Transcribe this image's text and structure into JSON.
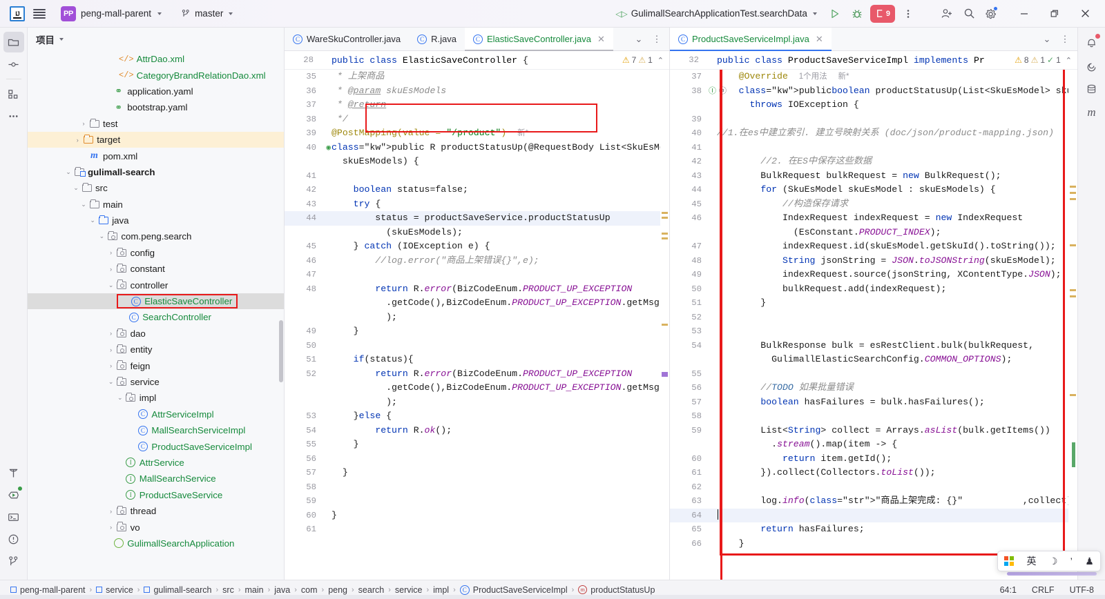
{
  "titlebar": {
    "logo_alt": "IJ",
    "project_badge": "PP",
    "project_name": "peng-mall-parent",
    "branch": "master",
    "run_config": "GulimallSearchApplicationTest.searchData",
    "run_count_badge": "9"
  },
  "rail": {
    "items": [
      {
        "name": "project-tool-window",
        "icon": "folder-icon"
      },
      {
        "name": "commit-tool-window",
        "icon": "commit-icon"
      },
      {
        "name": "structure-tool-window",
        "icon": "structure-icon"
      },
      {
        "name": "more-tool-windows",
        "icon": "more-icon"
      },
      {
        "name": "build-tool-window",
        "icon": "hammer-icon"
      },
      {
        "name": "run-tool-window",
        "icon": "run-icon"
      },
      {
        "name": "terminal-tool-window",
        "icon": "terminal-icon"
      },
      {
        "name": "problems-tool-window",
        "icon": "warning-icon"
      },
      {
        "name": "version-control-tool-window",
        "icon": "branch-icon"
      }
    ]
  },
  "right_rail": {
    "items": [
      {
        "name": "notifications",
        "icon": "bell-icon"
      },
      {
        "name": "ai-assistant",
        "icon": "spiral-icon"
      },
      {
        "name": "database",
        "icon": "database-icon"
      },
      {
        "name": "maven",
        "icon": "maven-m-icon"
      }
    ]
  },
  "project": {
    "title": "项目",
    "tree": [
      {
        "indent": 5,
        "arrow": "",
        "icon": "xml-file",
        "label": "AttrDao.xml",
        "color": "green"
      },
      {
        "indent": 5,
        "arrow": "",
        "icon": "xml-file",
        "label": "CategoryBrandRelationDao.xml",
        "color": "green"
      },
      {
        "indent": 4.6,
        "arrow": "",
        "icon": "yaml-file",
        "label": "application.yaml",
        "color": "plain"
      },
      {
        "indent": 4.6,
        "arrow": "",
        "icon": "yaml-file",
        "label": "bootstrap.yaml",
        "color": "plain"
      },
      {
        "indent": 3,
        "arrow": "right",
        "icon": "folder",
        "label": "test",
        "color": "plain"
      },
      {
        "indent": 2.6,
        "arrow": "right",
        "icon": "folder-orange",
        "label": "target",
        "color": "plain",
        "highlight": true
      },
      {
        "indent": 3,
        "arrow": "",
        "icon": "maven-m",
        "label": "pom.xml",
        "color": "plain"
      },
      {
        "indent": 2,
        "arrow": "down",
        "icon": "module",
        "label": "gulimall-search",
        "color": "plain",
        "bold": true
      },
      {
        "indent": 2.5,
        "arrow": "down",
        "icon": "folder",
        "label": "src",
        "color": "plain"
      },
      {
        "indent": 3,
        "arrow": "down",
        "icon": "folder",
        "label": "main",
        "color": "plain"
      },
      {
        "indent": 3.6,
        "arrow": "down",
        "icon": "folder-blue",
        "label": "java",
        "color": "plain"
      },
      {
        "indent": 4.2,
        "arrow": "down",
        "icon": "package",
        "label": "com.peng.search",
        "color": "plain"
      },
      {
        "indent": 4.8,
        "arrow": "right",
        "icon": "package",
        "label": "config",
        "color": "plain"
      },
      {
        "indent": 4.8,
        "arrow": "right",
        "icon": "package",
        "label": "constant",
        "color": "plain"
      },
      {
        "indent": 4.8,
        "arrow": "down",
        "icon": "package",
        "label": "controller",
        "color": "plain"
      },
      {
        "indent": 5.6,
        "arrow": "",
        "icon": "class",
        "label": "ElasticSaveController",
        "color": "green",
        "selected": true,
        "boxed": true
      },
      {
        "indent": 5.6,
        "arrow": "",
        "icon": "class",
        "label": "SearchController",
        "color": "green"
      },
      {
        "indent": 4.8,
        "arrow": "right",
        "icon": "package",
        "label": "dao",
        "color": "plain"
      },
      {
        "indent": 4.8,
        "arrow": "right",
        "icon": "package",
        "label": "entity",
        "color": "plain"
      },
      {
        "indent": 4.8,
        "arrow": "right",
        "icon": "package",
        "label": "feign",
        "color": "plain"
      },
      {
        "indent": 4.8,
        "arrow": "down",
        "icon": "package",
        "label": "service",
        "color": "plain"
      },
      {
        "indent": 5.4,
        "arrow": "down",
        "icon": "package",
        "label": "impl",
        "color": "plain"
      },
      {
        "indent": 6.2,
        "arrow": "",
        "icon": "class",
        "label": "AttrServiceImpl",
        "color": "green"
      },
      {
        "indent": 6.2,
        "arrow": "",
        "icon": "class",
        "label": "MallSearchServiceImpl",
        "color": "green"
      },
      {
        "indent": 6.2,
        "arrow": "",
        "icon": "class",
        "label": "ProductSaveServiceImpl",
        "color": "green"
      },
      {
        "indent": 5.4,
        "arrow": "",
        "icon": "interface",
        "label": "AttrService",
        "color": "green"
      },
      {
        "indent": 5.4,
        "arrow": "",
        "icon": "interface",
        "label": "MallSearchService",
        "color": "green"
      },
      {
        "indent": 5.4,
        "arrow": "",
        "icon": "interface",
        "label": "ProductSaveService",
        "color": "green"
      },
      {
        "indent": 4.8,
        "arrow": "right",
        "icon": "package",
        "label": "thread",
        "color": "plain"
      },
      {
        "indent": 4.8,
        "arrow": "right",
        "icon": "package",
        "label": "vo",
        "color": "plain"
      },
      {
        "indent": 4.6,
        "arrow": "",
        "icon": "spring",
        "label": "GulimallSearchApplication",
        "color": "green"
      }
    ]
  },
  "left_pane": {
    "tabs": [
      {
        "label": "WareSkuController.java",
        "icon": "class-icon",
        "active": false,
        "color": "blue"
      },
      {
        "label": "R.java",
        "icon": "class-icon",
        "active": false,
        "color": "blue"
      },
      {
        "label": "ElasticSaveController.java",
        "icon": "class-icon",
        "active": true,
        "color": "green",
        "closable": true
      }
    ],
    "sticky": {
      "line": "28",
      "text": "public class ElasticSaveController {",
      "warnings": "7",
      "weak_warnings": "1"
    },
    "lines": [
      {
        "n": "35",
        "text": " * 上架商品"
      },
      {
        "n": "36",
        "text": " * @param skuEsModels"
      },
      {
        "n": "37",
        "text": " * @return"
      },
      {
        "n": "38",
        "text": " */"
      },
      {
        "n": "39",
        "text": "@PostMapping(value = \"/product\")  新*"
      },
      {
        "n": "40",
        "text": "public R productStatusUp(@RequestBody List<SkuEsModel>"
      },
      {
        "n": "",
        "text": "  skuEsModels) {"
      },
      {
        "n": "41",
        "text": ""
      },
      {
        "n": "42",
        "text": "    boolean status=false;"
      },
      {
        "n": "43",
        "text": "    try {"
      },
      {
        "n": "44",
        "text": "        status = productSaveService.productStatusUp",
        "highlight": true
      },
      {
        "n": "",
        "text": "          (skuEsModels);"
      },
      {
        "n": "45",
        "text": "    } catch (IOException e) {"
      },
      {
        "n": "46",
        "text": "        //log.error(\"商品上架错误{}\",e);"
      },
      {
        "n": "47",
        "text": ""
      },
      {
        "n": "48",
        "text": "        return R.error(BizCodeEnum.PRODUCT_UP_EXCEPTION"
      },
      {
        "n": "",
        "text": "          .getCode(),BizCodeEnum.PRODUCT_UP_EXCEPTION.getMsg()"
      },
      {
        "n": "",
        "text": "          );"
      },
      {
        "n": "49",
        "text": "    }"
      },
      {
        "n": "50",
        "text": ""
      },
      {
        "n": "51",
        "text": "    if(status){"
      },
      {
        "n": "52",
        "text": "        return R.error(BizCodeEnum.PRODUCT_UP_EXCEPTION"
      },
      {
        "n": "",
        "text": "          .getCode(),BizCodeEnum.PRODUCT_UP_EXCEPTION.getMsg()"
      },
      {
        "n": "",
        "text": "          );"
      },
      {
        "n": "53",
        "text": "    }else {"
      },
      {
        "n": "54",
        "text": "        return R.ok();"
      },
      {
        "n": "55",
        "text": "    }"
      },
      {
        "n": "56",
        "text": ""
      },
      {
        "n": "57",
        "text": "  }"
      },
      {
        "n": "58",
        "text": ""
      },
      {
        "n": "59",
        "text": ""
      },
      {
        "n": "60",
        "text": "}"
      },
      {
        "n": "61",
        "text": ""
      }
    ]
  },
  "right_pane": {
    "tabs": [
      {
        "label": "ProductSaveServiceImpl.java",
        "icon": "class-icon",
        "active": true,
        "color": "green",
        "closable": true
      }
    ],
    "sticky": {
      "line": "32",
      "text": "public class ProductSaveServiceImpl implements Pr",
      "warnings": "8",
      "weak_warnings": "1",
      "oks": "1"
    },
    "lines": [
      {
        "n": "37",
        "text": "    @Override  1个用法  新*"
      },
      {
        "n": "38",
        "text": "    public boolean productStatusUp(List<SkuEsModel> skuEsModels)"
      },
      {
        "n": "",
        "text": "      throws IOException {"
      },
      {
        "n": "39",
        "text": ""
      },
      {
        "n": "40",
        "text": "//1.在es中建立索引. 建立号映射关系 (doc/json/product-mapping.json)"
      },
      {
        "n": "41",
        "text": ""
      },
      {
        "n": "42",
        "text": "        //2. 在ES中保存这些数据"
      },
      {
        "n": "43",
        "text": "        BulkRequest bulkRequest = new BulkRequest();"
      },
      {
        "n": "44",
        "text": "        for (SkuEsModel skuEsModel : skuEsModels) {"
      },
      {
        "n": "45",
        "text": "            //构造保存请求"
      },
      {
        "n": "46",
        "text": "            IndexRequest indexRequest = new IndexRequest"
      },
      {
        "n": "",
        "text": "              (EsConstant.PRODUCT_INDEX);"
      },
      {
        "n": "47",
        "text": "            indexRequest.id(skuEsModel.getSkuId().toString());"
      },
      {
        "n": "48",
        "text": "            String jsonString = JSON.toJSONString(skuEsModel);"
      },
      {
        "n": "49",
        "text": "            indexRequest.source(jsonString, XContentType.JSON);"
      },
      {
        "n": "50",
        "text": "            bulkRequest.add(indexRequest);"
      },
      {
        "n": "51",
        "text": "        }"
      },
      {
        "n": "52",
        "text": ""
      },
      {
        "n": "53",
        "text": ""
      },
      {
        "n": "54",
        "text": "        BulkResponse bulk = esRestClient.bulk(bulkRequest,"
      },
      {
        "n": "",
        "text": "          GulimallElasticSearchConfig.COMMON_OPTIONS);"
      },
      {
        "n": "55",
        "text": ""
      },
      {
        "n": "56",
        "text": "        //TODO 如果批量错误"
      },
      {
        "n": "57",
        "text": "        boolean hasFailures = bulk.hasFailures();"
      },
      {
        "n": "58",
        "text": ""
      },
      {
        "n": "59",
        "text": "        List<String> collect = Arrays.asList(bulk.getItems())"
      },
      {
        "n": "",
        "text": "          .stream().map(item -> {"
      },
      {
        "n": "60",
        "text": "            return item.getId();"
      },
      {
        "n": "61",
        "text": "        }).collect(Collectors.toList());"
      },
      {
        "n": "62",
        "text": ""
      },
      {
        "n": "63",
        "text": "        log.info(\"商品上架完成: {}\",collect);"
      },
      {
        "n": "64",
        "text": "",
        "cursor": true,
        "highlight": true
      },
      {
        "n": "65",
        "text": "        return hasFailures;"
      },
      {
        "n": "66",
        "text": "    }"
      }
    ]
  },
  "statusbar": {
    "breadcrumb": [
      {
        "label": "peng-mall-parent",
        "icon": "module-icon"
      },
      {
        "label": "service",
        "icon": "module-icon"
      },
      {
        "label": "gulimall-search",
        "icon": "module-icon"
      },
      {
        "label": "src",
        "icon": ""
      },
      {
        "label": "main",
        "icon": ""
      },
      {
        "label": "java",
        "icon": ""
      },
      {
        "label": "com",
        "icon": ""
      },
      {
        "label": "peng",
        "icon": ""
      },
      {
        "label": "search",
        "icon": ""
      },
      {
        "label": "service",
        "icon": ""
      },
      {
        "label": "impl",
        "icon": ""
      },
      {
        "label": "ProductSaveServiceImpl",
        "icon": "class-icon"
      },
      {
        "label": "productStatusUp",
        "icon": "method-icon"
      }
    ],
    "caret": "64:1",
    "line_sep": "CRLF",
    "encoding": "UTF-8"
  },
  "ime": {
    "lang": "英",
    "mode_glyph": "☽",
    "punct_glyph": "’",
    "tool_glyph": "♟"
  },
  "colors": {
    "accent": "#3574f0",
    "red_box": "#e8191a",
    "green_text": "#168a3c",
    "run_red": "#e8596a",
    "highlight": "#fdf0d5"
  }
}
